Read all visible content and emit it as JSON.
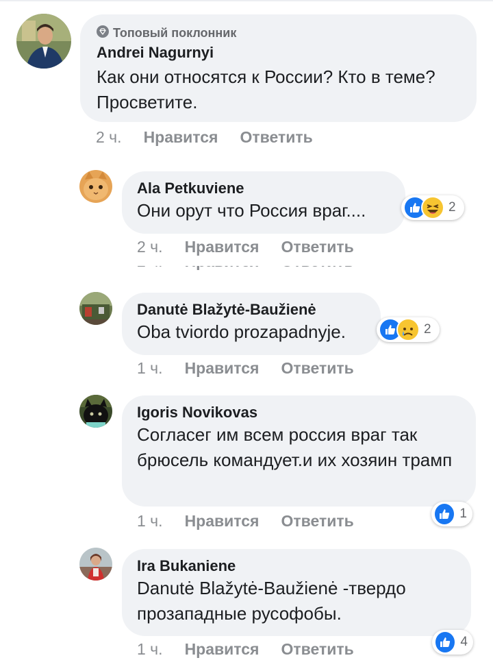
{
  "comments": [
    {
      "badge": "Топовый поклонник",
      "author": "Andrei Nagurnyi",
      "text": "Как они относятся к России? Кто в теме? Просветите.",
      "time": "2 ч.",
      "like_label": "Нравится",
      "reply_label": "Ответить"
    },
    {
      "author": "Ala Petkuviene",
      "text": "Они орут что Россия враг....",
      "time": "2 ч.",
      "like_label": "Нравится",
      "reply_label": "Ответить",
      "reactions": [
        "like-icon",
        "haha-icon"
      ],
      "reaction_count": "2"
    },
    {
      "author": "Danutė Blažytė-Baužienė",
      "text": "Oba tviordo prozapadnyje.",
      "time": "1 ч.",
      "like_label": "Нравится",
      "reply_label": "Ответить",
      "reactions": [
        "like-icon",
        "sad-icon"
      ],
      "reaction_count": "2"
    },
    {
      "author": "Igoris Novikovas",
      "text": "Согласег им всем россия враг так брюсель командует.и их хозяин трамп",
      "time": "1 ч.",
      "like_label": "Нравится",
      "reply_label": "Ответить",
      "reactions": [
        "like-icon"
      ],
      "reaction_count": "1"
    },
    {
      "author": "Ira Bukaniene",
      "text": "Danutė Blažytė-Baužienė -твердо прозападные русофобы.",
      "time": "1 ч.",
      "like_label": "Нравится",
      "reply_label": "Ответить",
      "reactions": [
        "like-icon"
      ],
      "reaction_count": "4"
    }
  ],
  "colors": {
    "bubble": "#f0f2f5",
    "like_blue": "#1877f2",
    "meta_gray": "#8a8d91"
  }
}
